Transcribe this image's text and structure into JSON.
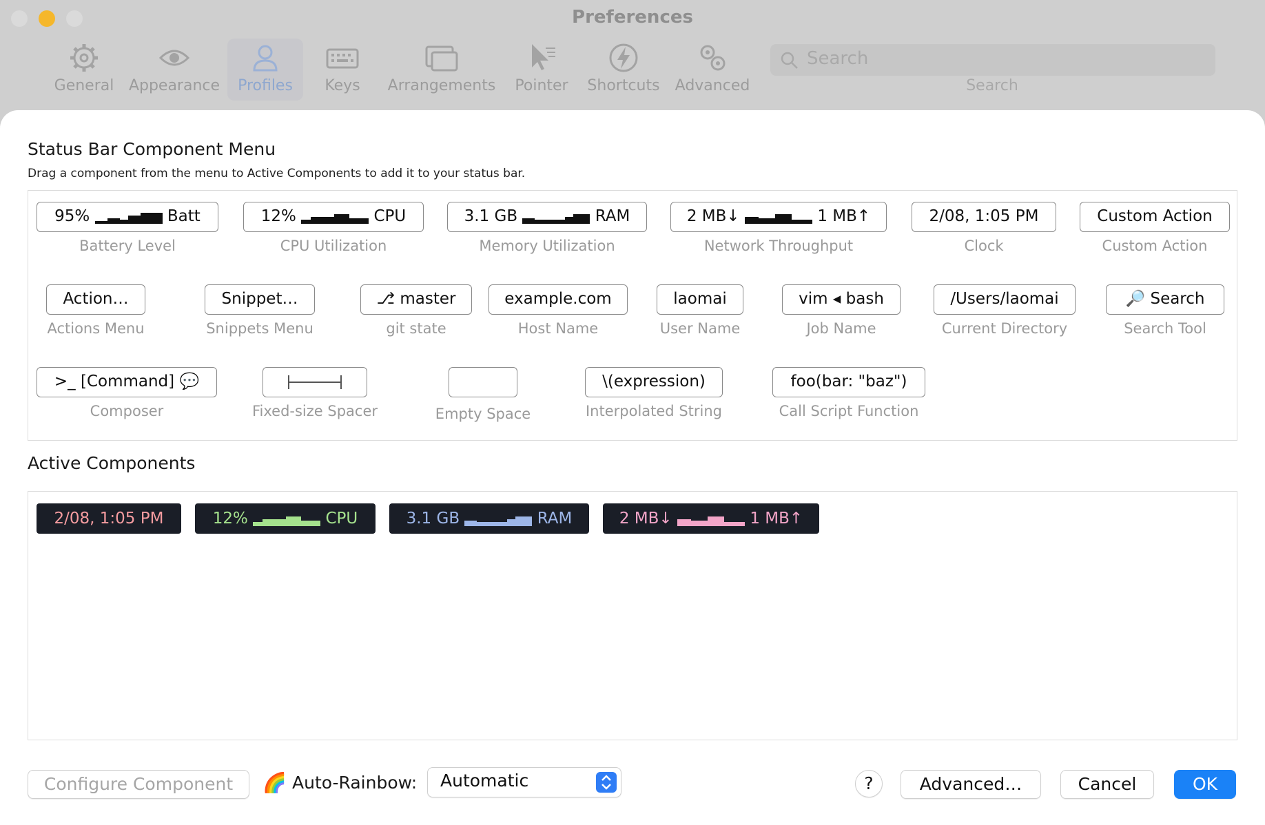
{
  "window": {
    "title": "Preferences"
  },
  "colors": {
    "accent": "#1a82f7",
    "traffic_yellow": "#f5b72b"
  },
  "toolbar": {
    "items": [
      {
        "label": "General",
        "icon": "gear-icon"
      },
      {
        "label": "Appearance",
        "icon": "eye-icon"
      },
      {
        "label": "Profiles",
        "icon": "person-icon",
        "selected": true
      },
      {
        "label": "Keys",
        "icon": "keyboard-icon"
      },
      {
        "label": "Arrangements",
        "icon": "windows-icon"
      },
      {
        "label": "Pointer",
        "icon": "cursor-icon"
      },
      {
        "label": "Shortcuts",
        "icon": "bolt-icon"
      },
      {
        "label": "Advanced",
        "icon": "gears-icon"
      }
    ],
    "search": {
      "placeholder": "Search",
      "label": "Search"
    }
  },
  "menu": {
    "title": "Status Bar Component Menu",
    "description": "Drag a component from the menu to Active Components to add it to your status bar.",
    "components": [
      {
        "chip_pre": "95%",
        "chip_post": "Batt",
        "caption": "Battery Level",
        "icon": "sparkline-icon"
      },
      {
        "chip_pre": "12%",
        "chip_post": "CPU",
        "caption": "CPU Utilization",
        "icon": "sparkline-icon"
      },
      {
        "chip_pre": "3.1 GB",
        "chip_post": "RAM",
        "caption": "Memory Utilization",
        "icon": "sparkline-icon"
      },
      {
        "chip_pre": "2 MB↓",
        "chip_post": "1 MB↑",
        "caption": "Network Throughput",
        "icon": "sparkline-icon"
      },
      {
        "chip": "2/08, 1:05 PM",
        "caption": "Clock"
      },
      {
        "chip": "Custom Action",
        "caption": "Custom Action"
      },
      {
        "chip": "Action…",
        "caption": "Actions Menu"
      },
      {
        "chip": "Snippet…",
        "caption": "Snippets Menu"
      },
      {
        "chip": "⎇ master",
        "caption": "git state",
        "icon": "git-branch-icon"
      },
      {
        "chip": "example.com",
        "caption": "Host Name"
      },
      {
        "chip": "laomai",
        "caption": "User Name"
      },
      {
        "chip": "vim ◂ bash",
        "caption": "Job Name"
      },
      {
        "chip": "/Users/laomai",
        "caption": "Current Directory"
      },
      {
        "chip": "🔎 Search",
        "caption": "Search Tool",
        "icon": "magnifier-icon"
      },
      {
        "chip": ">_ [Command] 💬",
        "caption": "Composer",
        "icon": "speech-bubble-icon"
      },
      {
        "chip": "",
        "caption": "Fixed-size Spacer",
        "icon": "spacer-icon"
      },
      {
        "chip": "",
        "caption": "Empty Space"
      },
      {
        "chip": "\\(expression)",
        "caption": "Interpolated String"
      },
      {
        "chip": "foo(bar: \"baz\")",
        "caption": "Call Script Function"
      }
    ]
  },
  "active": {
    "title": "Active Components",
    "items": [
      {
        "pre": "2/08, 1:05 PM",
        "post": "",
        "color": "#f59ca0"
      },
      {
        "pre": "12%",
        "post": "CPU",
        "color": "#a5e28d"
      },
      {
        "pre": "3.1 GB",
        "post": "RAM",
        "color": "#9db6e8"
      },
      {
        "pre": "2 MB↓",
        "post": "1 MB↑",
        "color": "#f3a5c8"
      }
    ]
  },
  "bottom": {
    "configure": "Configure Component",
    "rainbow_icon": "🌈",
    "rainbow_label": "Auto-Rainbow:",
    "rainbow_value": "Automatic",
    "help": "?",
    "advanced": "Advanced…",
    "cancel": "Cancel",
    "ok": "OK"
  }
}
